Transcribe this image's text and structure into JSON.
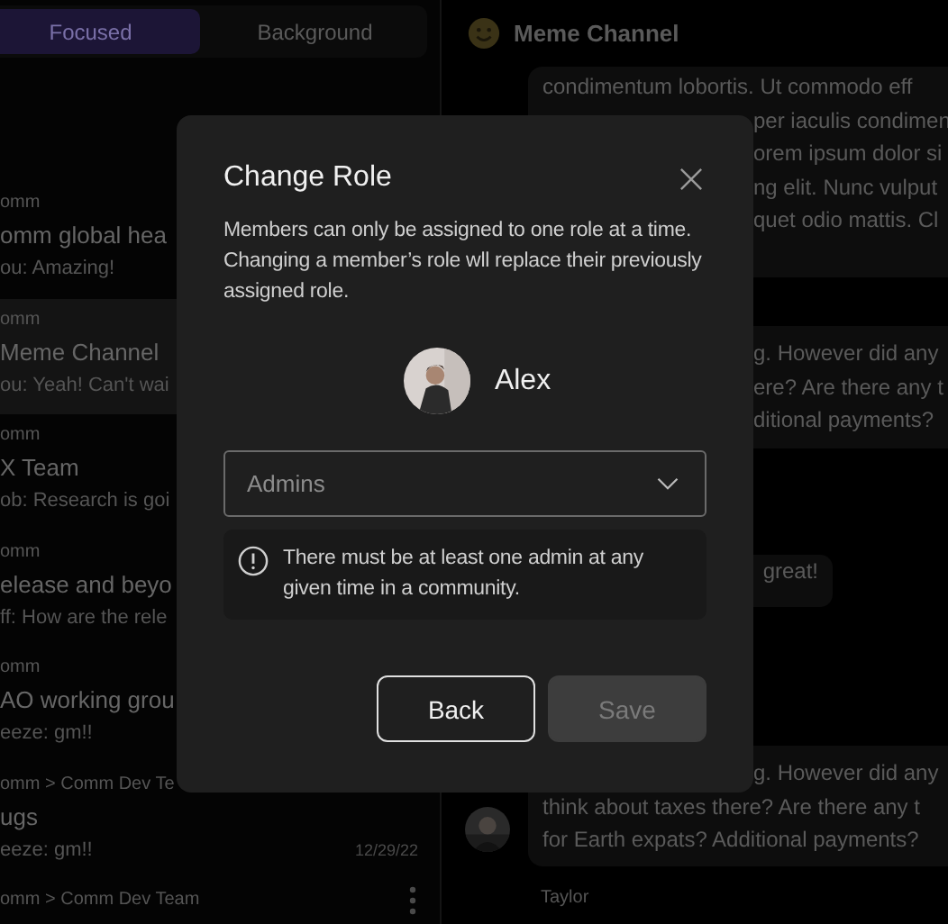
{
  "sidebar": {
    "tabs": [
      {
        "label": "Focused",
        "selected": true
      },
      {
        "label": "Background",
        "selected": false
      }
    ],
    "threads": [
      {
        "community": "omm",
        "name": "omm global hea",
        "preview": "ou: Amazing!",
        "selected": false
      },
      {
        "community": "omm",
        "name": "Meme Channel",
        "preview": "ou: Yeah! Can't wai",
        "selected": true
      },
      {
        "community": "omm",
        "name": "X Team",
        "preview": "ob: Research is goi",
        "selected": false
      },
      {
        "community": "omm",
        "name": "elease and beyo",
        "preview": "ff: How are the rele",
        "selected": false
      },
      {
        "community": "omm",
        "name": "AO working grou",
        "preview": "eeze: gm!!",
        "selected": false
      },
      {
        "community": "omm > Comm Dev Te",
        "name": "ugs",
        "preview": "eeze: gm!!",
        "date": "12/29/22",
        "selected": false
      },
      {
        "community": "omm > Comm Dev Team",
        "menu": true,
        "selected": false
      }
    ]
  },
  "chat": {
    "title": "Meme Channel",
    "messages": [
      {
        "kind": "bubble",
        "lines": [
          "condimentum lobortis. Ut commodo eff"
        ],
        "line_ends": [
          "per iaculis condimen",
          "orem ipsum dolor si",
          "ng elit. Nunc vulput",
          "quet odio mattis. Cl"
        ]
      },
      {
        "kind": "bubble",
        "line_ends": [
          "g. However did any",
          "ere? Are there any t",
          "ditional payments?"
        ]
      },
      {
        "kind": "short",
        "line_ends": [
          "great!"
        ]
      },
      {
        "kind": "avatar",
        "line_ends": [
          "g. However did any"
        ],
        "lines": [
          "think about taxes there? Are there any t",
          "for Earth expats? Additional payments?"
        ]
      },
      {
        "kind": "author",
        "author": "Taylor"
      }
    ]
  },
  "dialog": {
    "title": "Change Role",
    "description": "Members can only be assigned to one role at a time. Changing a member’s role wll replace their previously assigned role.",
    "member": "Alex",
    "role": "Admins",
    "notice": "There must be at least one admin at any given time in a community.",
    "buttons": [
      {
        "label": "Back",
        "disabled": false
      },
      {
        "label": "Save",
        "disabled": true
      }
    ]
  }
}
